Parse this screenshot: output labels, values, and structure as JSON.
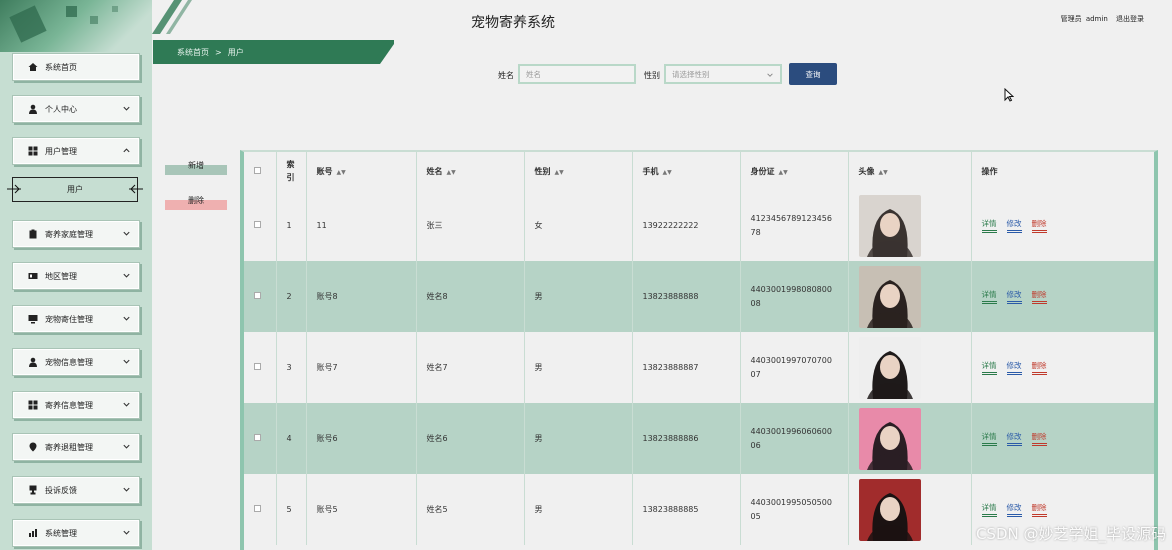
{
  "app": {
    "title": "宠物寄养系统"
  },
  "user_info": {
    "role": "管理员",
    "username": "admin",
    "logout": "退出登录"
  },
  "breadcrumb": {
    "home": "系统首页",
    "separator": ">",
    "current": "用户"
  },
  "sidebar": {
    "items": [
      {
        "label": "系统首页",
        "icon": "home-icon"
      },
      {
        "label": "个人中心",
        "icon": "person-icon"
      },
      {
        "label": "用户管理",
        "icon": "grid-icon"
      },
      {
        "label": "寄养家庭管理",
        "icon": "clipboard-icon"
      },
      {
        "label": "地区管理",
        "icon": "id-card-icon"
      },
      {
        "label": "宠物寄住管理",
        "icon": "monitor-icon"
      },
      {
        "label": "宠物信息管理",
        "icon": "person-icon"
      },
      {
        "label": "寄养信息管理",
        "icon": "grid-icon"
      },
      {
        "label": "寄养退租管理",
        "icon": "location-icon"
      },
      {
        "label": "投诉反馈",
        "icon": "trophy-icon"
      },
      {
        "label": "系统管理",
        "icon": "chart-icon"
      }
    ],
    "sub_item": {
      "label": "用户"
    }
  },
  "search": {
    "name_label": "姓名",
    "name_placeholder": "姓名",
    "gender_label": "性别",
    "gender_placeholder": "请选择性别",
    "button": "查询"
  },
  "actions": {
    "add": "新增",
    "delete": "删除"
  },
  "table": {
    "headers": [
      "索引",
      "账号",
      "姓名",
      "性别",
      "手机",
      "身份证",
      "头像",
      "操作"
    ],
    "rows": [
      {
        "index": "1",
        "account": "11",
        "name": "张三",
        "gender": "女",
        "phone": "13922222222",
        "idcard": "412345678912345678"
      },
      {
        "index": "2",
        "account": "账号8",
        "name": "姓名8",
        "gender": "男",
        "phone": "13823888888",
        "idcard": "440300199808080008"
      },
      {
        "index": "3",
        "account": "账号7",
        "name": "姓名7",
        "gender": "男",
        "phone": "13823888887",
        "idcard": "440300199707070007"
      },
      {
        "index": "4",
        "account": "账号6",
        "name": "姓名6",
        "gender": "男",
        "phone": "13823888886",
        "idcard": "440300199606060006"
      },
      {
        "index": "5",
        "account": "账号5",
        "name": "姓名5",
        "gender": "男",
        "phone": "13823888885",
        "idcard": "440300199505050005"
      }
    ],
    "ops": {
      "detail": "详情",
      "edit": "修改",
      "delete": "删除"
    }
  },
  "watermark": "CSDN @妙芝学姐_毕设源码",
  "colors": {
    "sidebar_bg": "#c6ded2",
    "accent_green": "#2f7a55",
    "search_button": "#2b4c7e",
    "row_alt": "#b6d3c6"
  }
}
